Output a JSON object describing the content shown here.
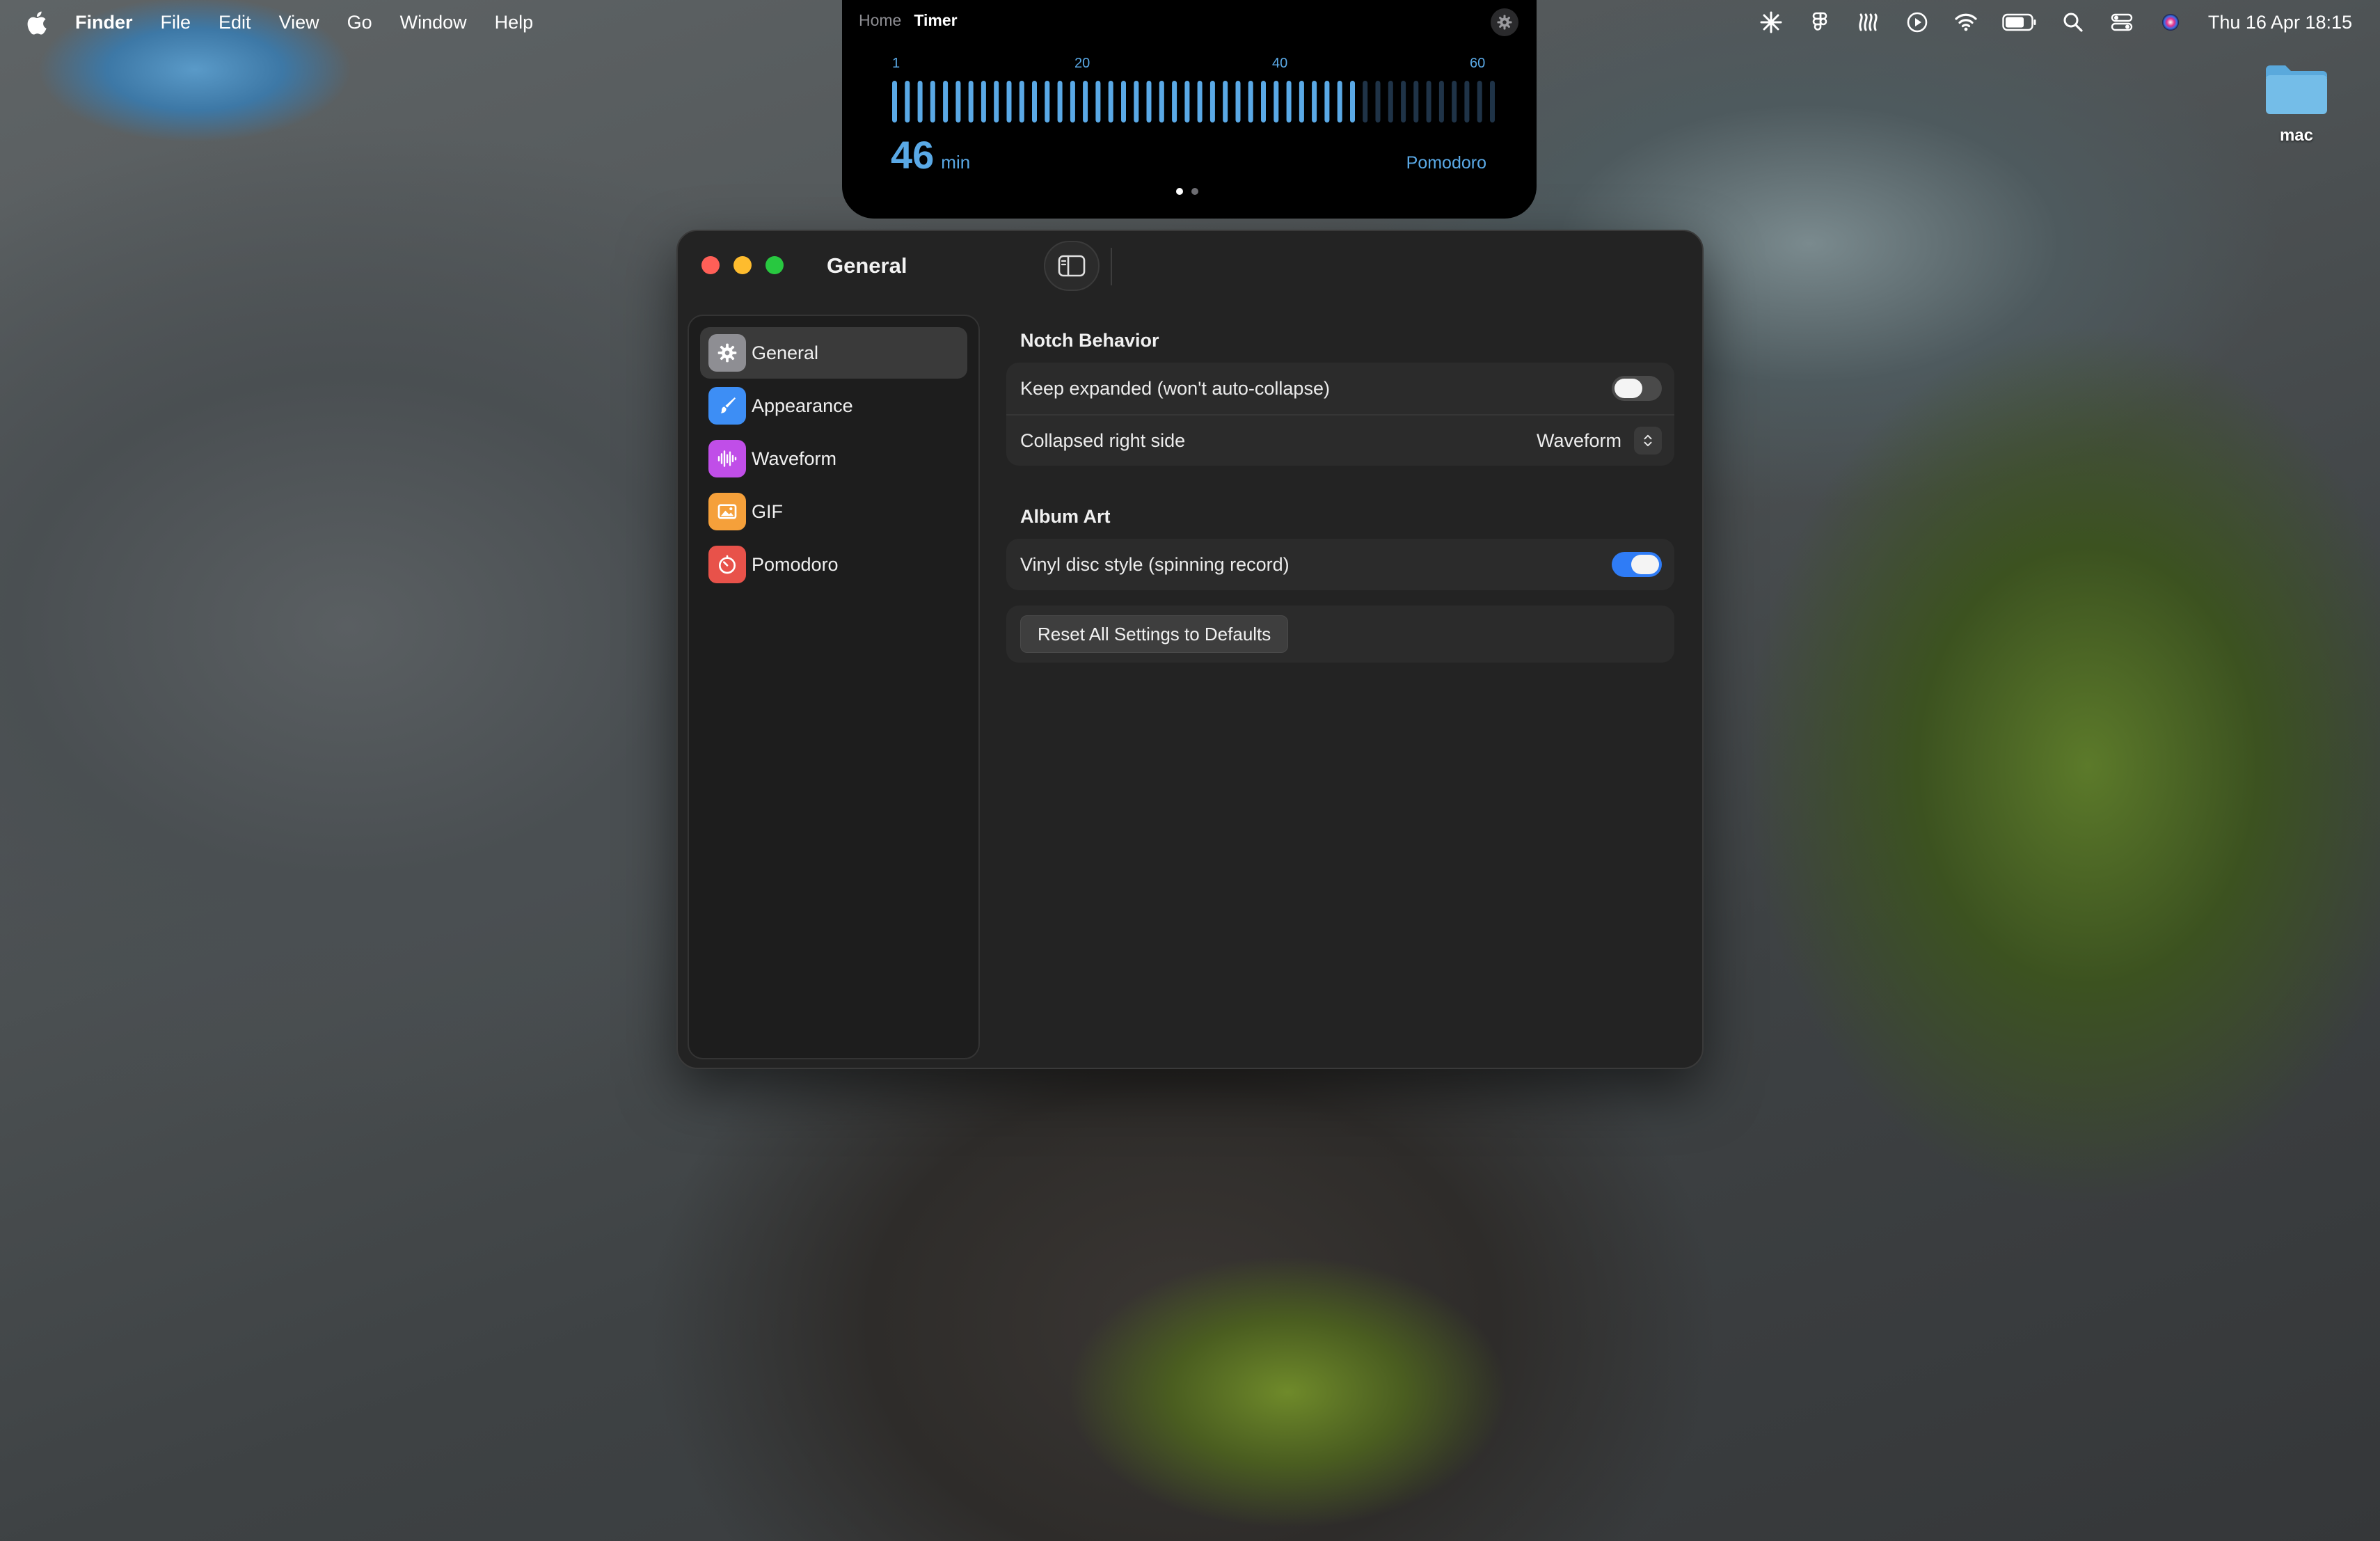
{
  "menubar": {
    "app_name": "Finder",
    "items": [
      "File",
      "Edit",
      "View",
      "Go",
      "Window",
      "Help"
    ],
    "clock": "Thu 16 Apr  18:15",
    "status_icons": [
      "sparkle-icon",
      "figma-icon",
      "waves-icon",
      "play-circle-icon",
      "wifi-icon",
      "battery-icon",
      "search-icon",
      "control-center-icon",
      "siri-icon"
    ]
  },
  "notch": {
    "tab_home": "Home",
    "tab_timer": "Timer",
    "scale_labels": [
      "1",
      "20",
      "40",
      "60"
    ],
    "minutes": "46",
    "unit": "min",
    "mode": "Pomodoro",
    "slider": {
      "min": 1,
      "max": 60,
      "value": 46
    },
    "accent_color": "#5aa9e6",
    "page_dots": 2,
    "active_dot": 0
  },
  "desktop": {
    "folder_label": "mac"
  },
  "window": {
    "title": "General",
    "sidebar": {
      "items": [
        {
          "label": "General",
          "icon": "gear-icon",
          "color": "#8e8e93",
          "active": true
        },
        {
          "label": "Appearance",
          "icon": "paintbrush-icon",
          "color": "#3d8ef5",
          "active": false
        },
        {
          "label": "Waveform",
          "icon": "waveform-icon",
          "color": "#c04ee8",
          "active": false
        },
        {
          "label": "GIF",
          "icon": "photo-icon",
          "color": "#f5a03a",
          "active": false
        },
        {
          "label": "Pomodoro",
          "icon": "timer-icon",
          "color": "#e8524a",
          "active": false
        }
      ]
    },
    "notch_behavior": {
      "title": "Notch Behavior",
      "keep_expanded_label": "Keep expanded (won't auto-collapse)",
      "keep_expanded_on": false,
      "collapsed_right_label": "Collapsed right side",
      "collapsed_right_value": "Waveform"
    },
    "album_art": {
      "title": "Album Art",
      "vinyl_label": "Vinyl disc style (spinning record)",
      "vinyl_on": true
    },
    "reset_label": "Reset All Settings to Defaults"
  }
}
